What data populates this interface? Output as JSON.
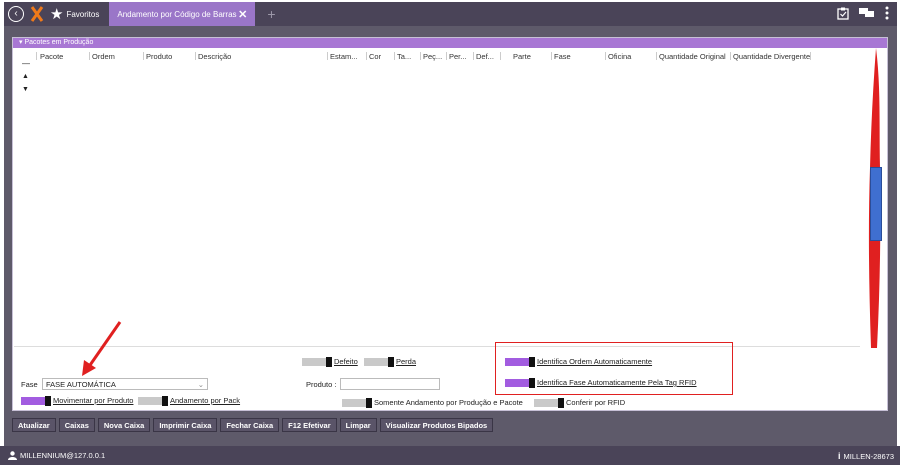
{
  "topbar": {
    "favorites_label": "Favoritos",
    "active_tab": "Andamento por Código de Barras",
    "tab_close": "✕",
    "add_tab": "+"
  },
  "panel": {
    "title": "Pacotes em Produção",
    "columns": [
      "Pacote",
      "Ordem",
      "Produto",
      "Descrição",
      "Estam...",
      "Cor",
      "Ta...",
      "Peç...",
      "Per...",
      "Def...",
      "Parte",
      "Fase",
      "Oficina",
      "Quantidade Original",
      "Quantidade Divergente"
    ]
  },
  "form": {
    "defeito_label": "Defeito",
    "perda_label": "Perda",
    "fase_label": "Fase",
    "fase_value": "FASE AUTOMÁTICA",
    "produto_label": "Produto :",
    "produto_value": "",
    "movimentar_label": "Movimentar por Produto",
    "andamento_pack_label": "Andamento por Pack",
    "somente_label": "Somente Andamento por Produção e Pacote",
    "conferir_label": "Conferir por RFID",
    "identifica_ordem_label": "Identifica Ordem Automaticamente",
    "identifica_fase_label": "Identifica Fase Automaticamente Pela Tag RFID"
  },
  "toolbar": {
    "buttons": [
      "Atualizar",
      "Caixas",
      "Nova Caixa",
      "Imprimir Caixa",
      "Fechar Caixa",
      "F12 Efetivar",
      "Limpar",
      "Visualizar Produtos Bipados"
    ]
  },
  "status": {
    "user": "MILLENNIUM@127.0.0.1",
    "version": "MILLEN-28673"
  },
  "colors": {
    "accent": "#a877d4",
    "toggle_on": "#a25ce0",
    "highlight": "#e02020"
  }
}
